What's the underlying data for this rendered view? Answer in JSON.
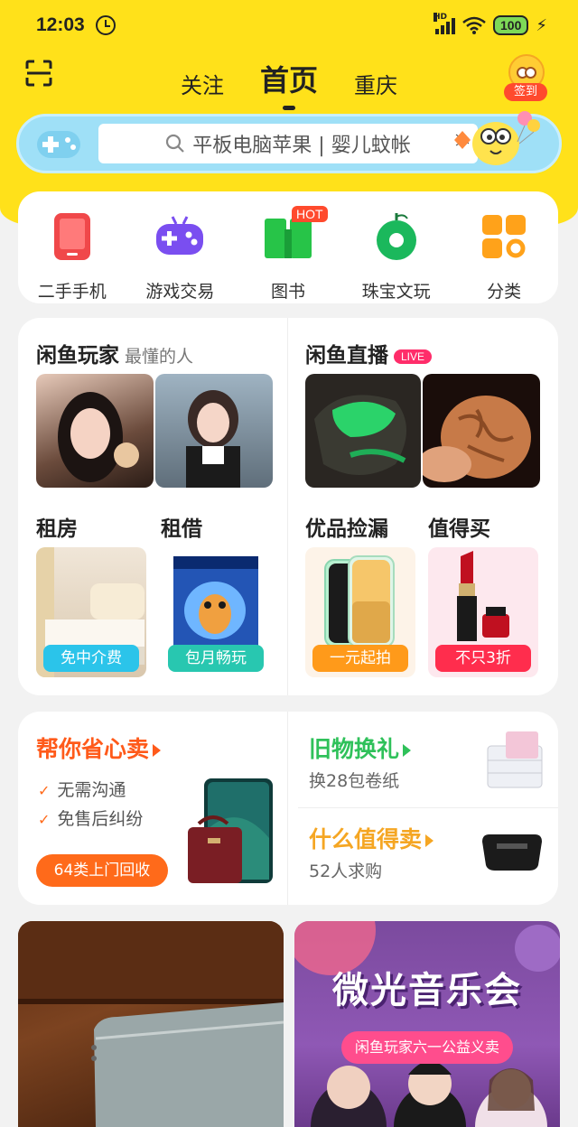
{
  "status_bar": {
    "time": "12:03",
    "battery": "100",
    "hd_label": "HD"
  },
  "header": {
    "tabs": [
      {
        "label": "关注",
        "active": false
      },
      {
        "label": "首页",
        "active": true
      },
      {
        "label": "重庆",
        "active": false
      }
    ],
    "signin_label": "签到"
  },
  "search": {
    "placeholder": "平板电脑苹果 | 婴儿蚊帐"
  },
  "categories": [
    {
      "label": "二手手机",
      "icon": "phone-icon",
      "color": "#f0484a"
    },
    {
      "label": "游戏交易",
      "icon": "gamepad-icon",
      "color": "#7a4ef0"
    },
    {
      "label": "图书",
      "icon": "book-icon",
      "color": "#27c448",
      "badge": "HOT"
    },
    {
      "label": "珠宝文玩",
      "icon": "jade-icon",
      "color": "#1bb85c"
    },
    {
      "label": "分类",
      "icon": "grid-icon",
      "color": "#ffa21a"
    }
  ],
  "featured": {
    "players": {
      "title": "闲鱼玩家",
      "subtitle": "最懂的人"
    },
    "live": {
      "title": "闲鱼直播",
      "badge": "LIVE"
    },
    "rent": {
      "title": "租房",
      "pill": "免中介费"
    },
    "borrow": {
      "title": "租借",
      "pill": "包月畅玩"
    },
    "picks": {
      "title": "优品捡漏",
      "pill": "一元起拍"
    },
    "worth": {
      "title": "值得买",
      "pill": "不只3折"
    }
  },
  "sell": {
    "title": "帮你省心卖",
    "points": [
      "无需沟通",
      "免售后纠纷"
    ],
    "button": "64类上门回收",
    "exchange": {
      "title": "旧物换礼",
      "subtitle": "换28包卷纸"
    },
    "worth_selling": {
      "title": "什么值得卖",
      "subtitle": "52人求购"
    }
  },
  "banners": {
    "concert_title": "微光音乐会",
    "concert_sub": "闲鱼玩家六一公益义卖"
  },
  "colors": {
    "brand_yellow": "#ffe11a",
    "accent_orange": "#ff6a1a",
    "green": "#2fc15a",
    "orange_title": "#f5a623"
  }
}
